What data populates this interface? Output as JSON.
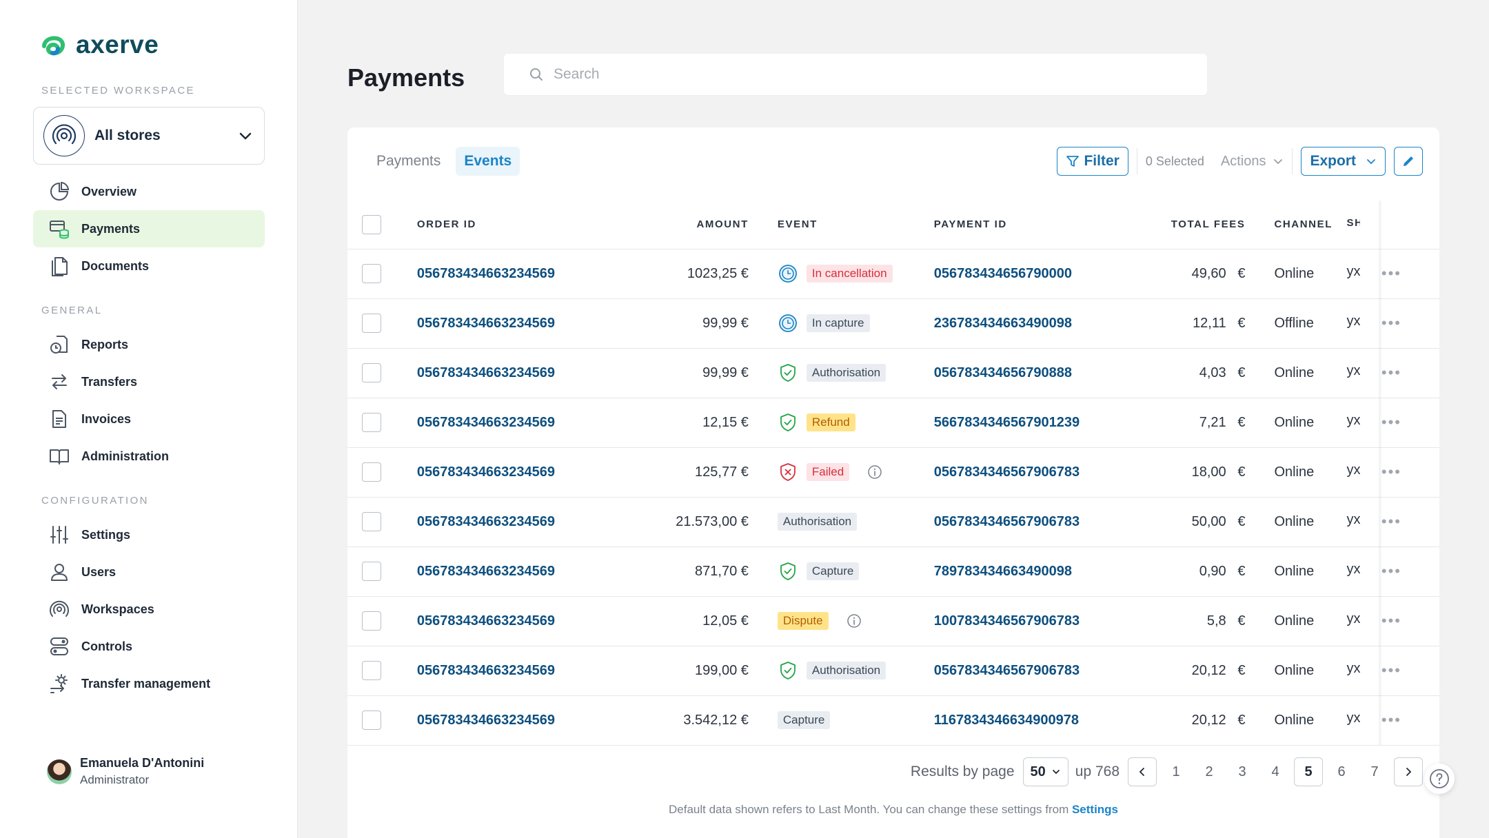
{
  "brand": {
    "name": "axerve",
    "accent": "#1a84c7"
  },
  "sidebar": {
    "selected_workspace_label": "SELECTED WORKSPACE",
    "workspace": "All stores",
    "general_label": "GENERAL",
    "configuration_label": "CONFIGURATION",
    "main_items": [
      {
        "label": "Overview",
        "icon": "pie-chart-icon"
      },
      {
        "label": "Payments",
        "icon": "payments-icon",
        "active": true
      },
      {
        "label": "Documents",
        "icon": "documents-icon"
      }
    ],
    "general_items": [
      {
        "label": "Reports",
        "icon": "reports-icon"
      },
      {
        "label": "Transfers",
        "icon": "transfers-icon"
      },
      {
        "label": "Invoices",
        "icon": "invoice-icon"
      },
      {
        "label": "Administration",
        "icon": "book-icon"
      }
    ],
    "configuration_items": [
      {
        "label": "Settings",
        "icon": "sliders-icon"
      },
      {
        "label": "Users",
        "icon": "user-icon"
      },
      {
        "label": "Workspaces",
        "icon": "workspace-icon"
      },
      {
        "label": "Controls",
        "icon": "toggles-icon"
      },
      {
        "label": "Transfer management",
        "icon": "transfer-gear-icon"
      }
    ],
    "user": {
      "name": "Emanuela D'Antonini",
      "role": "Administrator"
    }
  },
  "header": {
    "title": "Payments",
    "search_placeholder": "Search"
  },
  "tabs": [
    {
      "label": "Payments",
      "active": false
    },
    {
      "label": "Events",
      "active": true
    }
  ],
  "toolbar": {
    "filter": "Filter",
    "selected": "0 Selected",
    "actions": "Actions",
    "export": "Export"
  },
  "table": {
    "columns": [
      "ORDER ID",
      "AMOUNT",
      "EVENT",
      "PAYMENT ID",
      "TOTAL FEES",
      "CHANNEL",
      "SH"
    ],
    "rows": [
      {
        "order_id": "056783434663234569",
        "amount": "1023,25 €",
        "event": "In cancellation",
        "event_style": "red",
        "event_icon": "clock",
        "info": false,
        "payment_id": "056783434656790000",
        "fees": "49,60",
        "currency": "€",
        "channel": "Online",
        "sh": "yx"
      },
      {
        "order_id": "056783434663234569",
        "amount": "99,99 €",
        "event": "In capture",
        "event_style": "grey",
        "event_icon": "clock",
        "info": false,
        "payment_id": "236783434663490098",
        "fees": "12,11",
        "currency": "€",
        "channel": "Offline",
        "sh": "yx"
      },
      {
        "order_id": "056783434663234569",
        "amount": "99,99 €",
        "event": "Authorisation",
        "event_style": "grey",
        "event_icon": "shield-check",
        "info": false,
        "payment_id": "056783434656790888",
        "fees": "4,03",
        "currency": "€",
        "channel": "Online",
        "sh": "yx"
      },
      {
        "order_id": "056783434663234569",
        "amount": "12,15 €",
        "event": "Refund",
        "event_style": "yellow",
        "event_icon": "shield-check",
        "info": false,
        "payment_id": "5667834346567901239",
        "fees": "7,21",
        "currency": "€",
        "channel": "Online",
        "sh": "yx"
      },
      {
        "order_id": "056783434663234569",
        "amount": "125,77 €",
        "event": "Failed",
        "event_style": "red",
        "event_icon": "shield-x",
        "info": true,
        "payment_id": "0567834346567906783",
        "fees": "18,00",
        "currency": "€",
        "channel": "Online",
        "sh": "yx"
      },
      {
        "order_id": "056783434663234569",
        "amount": "21.573,00 €",
        "event": "Authorisation",
        "event_style": "grey",
        "event_icon": "none",
        "info": false,
        "payment_id": "0567834346567906783",
        "fees": "50,00",
        "currency": "€",
        "channel": "Online",
        "sh": "yx"
      },
      {
        "order_id": "056783434663234569",
        "amount": "871,70 €",
        "event": "Capture",
        "event_style": "grey",
        "event_icon": "shield-check",
        "info": false,
        "payment_id": "789783434663490098",
        "fees": "0,90",
        "currency": "€",
        "channel": "Online",
        "sh": "yx"
      },
      {
        "order_id": "056783434663234569",
        "amount": "12,05 €",
        "event": "Dispute",
        "event_style": "yellow",
        "event_icon": "none",
        "info": true,
        "payment_id": "1007834346567906783",
        "fees": "5,8",
        "currency": "€",
        "channel": "Online",
        "sh": "yx"
      },
      {
        "order_id": "056783434663234569",
        "amount": "199,00 €",
        "event": "Authorisation",
        "event_style": "grey",
        "event_icon": "shield-check",
        "info": false,
        "payment_id": "0567834346567906783",
        "fees": "20,12",
        "currency": "€",
        "channel": "Online",
        "sh": "yx"
      },
      {
        "order_id": "056783434663234569",
        "amount": "3.542,12 €",
        "event": "Capture",
        "event_style": "grey",
        "event_icon": "none",
        "info": false,
        "payment_id": "1167834346634900978",
        "fees": "20,12",
        "currency": "€",
        "channel": "Online",
        "sh": "yx"
      }
    ]
  },
  "pagination": {
    "results_label": "Results by page",
    "per_page": "50",
    "total": "up 768",
    "pages": [
      "1",
      "2",
      "3",
      "4",
      "5",
      "6",
      "7"
    ],
    "current": "5"
  },
  "footnote": {
    "text": "Default data shown refers to Last Month. You can change these settings from ",
    "link": "Settings"
  }
}
